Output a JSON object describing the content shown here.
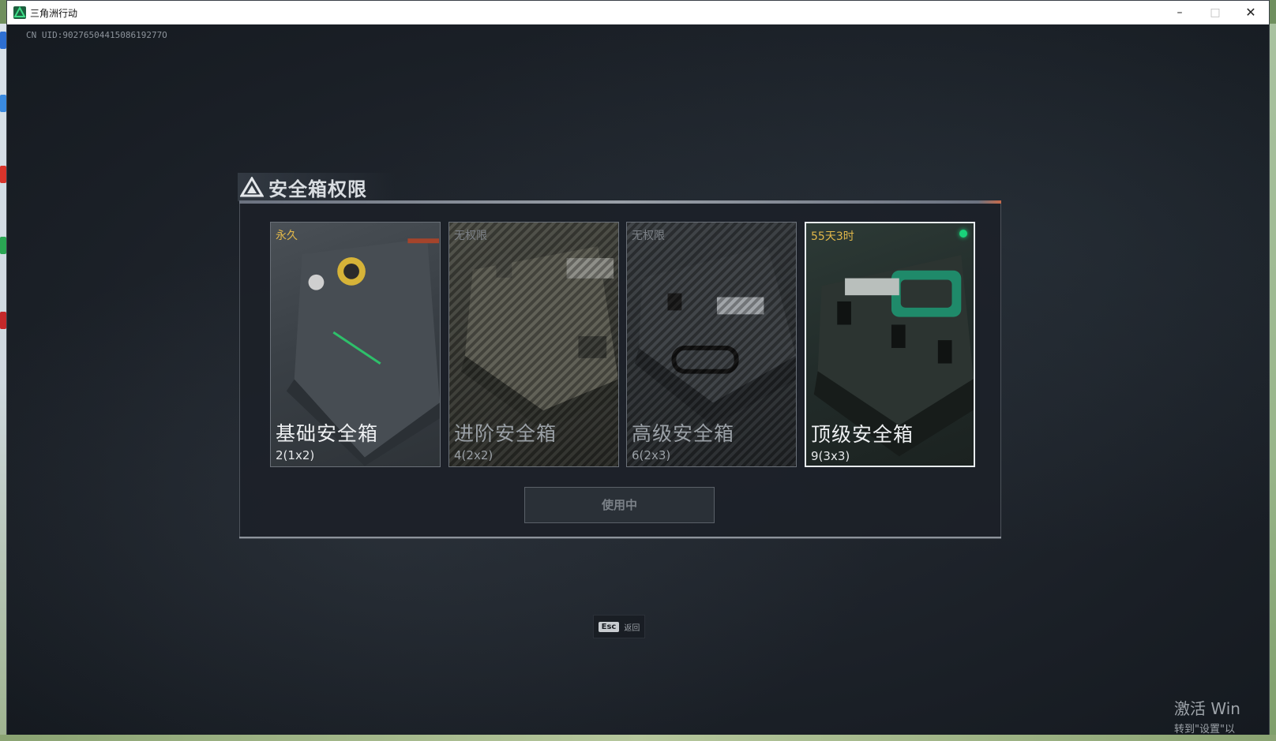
{
  "window": {
    "title": "三角洲行动",
    "minimize_glyph": "–",
    "maximize_glyph": "□",
    "close_glyph": "✕"
  },
  "uid_text": "CN UID:9027650441508619277O",
  "dialog": {
    "title": "安全箱权限",
    "cards": [
      {
        "badge": "永久",
        "name": "基础安全箱",
        "capacity": "2(1x2)",
        "state": "owned"
      },
      {
        "badge": "无权限",
        "name": "进阶安全箱",
        "capacity": "4(2x2)",
        "state": "locked"
      },
      {
        "badge": "无权限",
        "name": "高级安全箱",
        "capacity": "6(2x3)",
        "state": "locked"
      },
      {
        "badge": "55天3时",
        "name": "顶级安全箱",
        "capacity": "9(3x3)",
        "state": "active"
      }
    ],
    "use_button": "使用中"
  },
  "footer": {
    "esc_key": "Esc",
    "esc_label": "返回"
  },
  "activation": {
    "line1": "激活 Win",
    "line2": "转到\"设置\"以"
  },
  "colors": {
    "accent_gold": "#e2b84a",
    "active_dot": "#19d27a",
    "locked_text": "#7b8086"
  }
}
